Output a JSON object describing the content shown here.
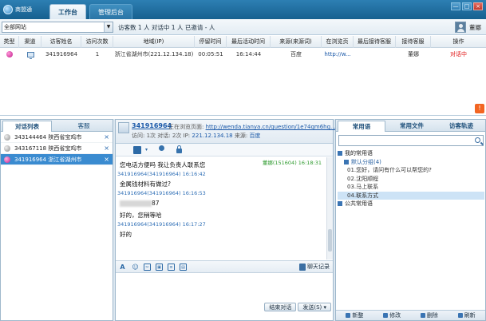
{
  "app": {
    "name": "商盟通"
  },
  "tabs": [
    {
      "label": "工作台"
    },
    {
      "label": "管理后台"
    }
  ],
  "window_controls": {
    "minimize": "—",
    "maximize": "□",
    "close": "×"
  },
  "filter": {
    "site_select": "全部网站",
    "summary": "访客数 1 人  对话中 1 人  已邀请 - 人",
    "agent_name": "董娜"
  },
  "visitor_table": {
    "headers": [
      "类型",
      "渠道",
      "访客姓名",
      "访问次数",
      "地域(IP)",
      "停留时间",
      "最后活动时间",
      "来源(来源词)",
      "在浏览页",
      "最后接待客服",
      "接待客服",
      "操作"
    ],
    "rows": [
      {
        "name": "341916964",
        "visits": "1",
        "region": "浙江省湖州市(221.12.134.18)",
        "stay": "00:05:51",
        "last_active": "16:14:44",
        "source": "百度",
        "page": "http://w...",
        "last_agent": "",
        "agent": "董娜",
        "action": "对话中"
      }
    ]
  },
  "left_panel": {
    "tabs": [
      "对话列表",
      "客服"
    ],
    "conversations": [
      {
        "id": "343144464",
        "location": "陕西省宝鸡市"
      },
      {
        "id": "343167118",
        "location": "陕西省宝鸡市"
      },
      {
        "id": "341916964",
        "location": "浙江省湖州市"
      }
    ]
  },
  "chat": {
    "visitor_name": "341916964",
    "browsing_label": "正在浏览页面:",
    "browsing_url": "http://wenda.tianya.cn/question/1e74qm6hg...",
    "visit_label": "访问: 1次 对话: 2次 IP: ",
    "ip": "221.12.134.18",
    "source_label": " 来源: ",
    "source": "百度",
    "messages": [
      {
        "meta": "",
        "text": "您电话方便吗  我让负责人联系您",
        "agent": false
      },
      {
        "meta": "341916964(341916964)  16:16:42",
        "text": "金属钱材料有做过?",
        "agent": false
      },
      {
        "meta": "341916964(341916964)  16:16:53",
        "text": "87",
        "agent": false,
        "blurred": true
      },
      {
        "meta": "董娜(151604)  16:18:31",
        "text": "好的，您稍等哈",
        "agent": true
      },
      {
        "meta": "341916964(341916964)  16:17:27",
        "text": "好的",
        "agent": false
      }
    ],
    "chat_log": "聊天记录",
    "end_button": "结束对话",
    "send_button": "发送(S)",
    "send_caret": "▾"
  },
  "right_panel": {
    "tabs": [
      "常用语",
      "常用文件",
      "访客轨迹"
    ],
    "tree": {
      "my_phrases": "我的常用语",
      "default_group": "默认分组(4)",
      "items": [
        "01.您好，请问有什么可以帮您的?",
        "02.沈阳顺程",
        "03.马上联系",
        "04.联系方式"
      ],
      "public_phrases": "公共常用语"
    },
    "bottom": [
      "新整",
      "修改",
      "删除",
      "刷新"
    ]
  }
}
